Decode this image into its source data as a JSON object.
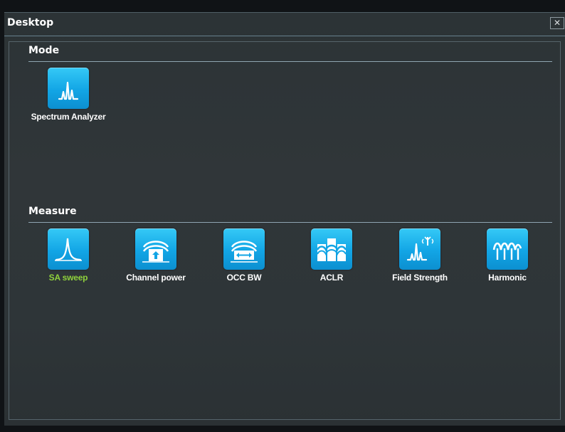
{
  "window": {
    "title": "Desktop",
    "close_glyph": "✕"
  },
  "mode": {
    "heading": "Mode",
    "tiles": [
      {
        "label": "Spectrum Analyzer",
        "icon": "spectrum-peaks-icon",
        "selected": false
      }
    ]
  },
  "measure": {
    "heading": "Measure",
    "tiles": [
      {
        "label": "SA sweep",
        "icon": "single-peak-icon",
        "selected": true
      },
      {
        "label": "Channel power",
        "icon": "channel-power-icon",
        "selected": false
      },
      {
        "label": "OCC BW",
        "icon": "occupied-bandwidth-icon",
        "selected": false
      },
      {
        "label": "ACLR",
        "icon": "aclr-icon",
        "selected": false
      },
      {
        "label": "Field Strength",
        "icon": "field-strength-icon",
        "selected": false
      },
      {
        "label": "Harmonic",
        "icon": "harmonic-icon",
        "selected": false
      }
    ]
  },
  "colors": {
    "accent": "#12a5e5",
    "selected_label": "#8fd23c",
    "background": "#2e3538"
  }
}
